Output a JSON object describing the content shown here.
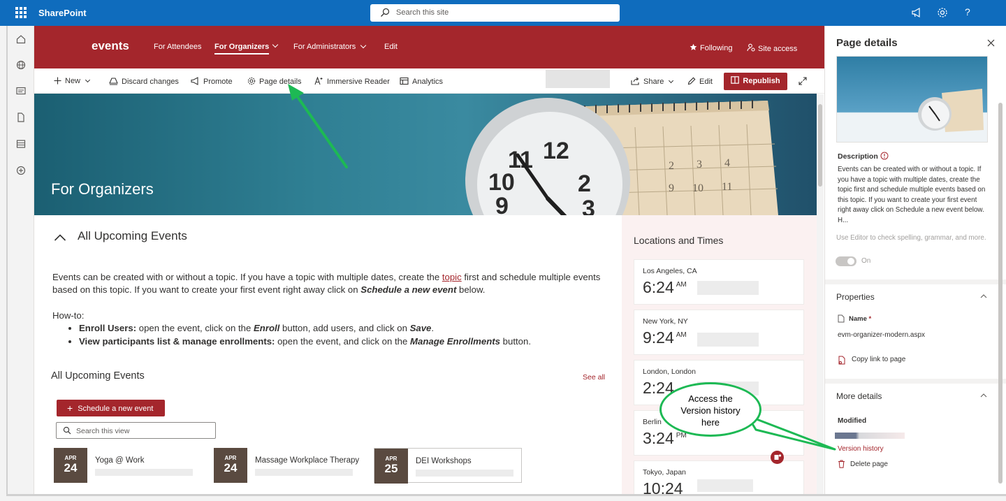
{
  "app": {
    "name": "SharePoint",
    "search_placeholder": "Search this site"
  },
  "colors": {
    "suite_bar": "#0f6cbd",
    "site_theme": "#a4262c",
    "annotation_green": "#1db954"
  },
  "site": {
    "name": "events",
    "nav": [
      {
        "label": "For Attendees",
        "active": false
      },
      {
        "label": "For Organizers",
        "active": true
      },
      {
        "label": "For Administrators",
        "active": false
      },
      {
        "label": "Edit",
        "active": false
      }
    ],
    "following": "Following",
    "site_access": "Site access"
  },
  "commands": {
    "new": "New",
    "discard": "Discard changes",
    "promote": "Promote",
    "page_details": "Page details",
    "immersive_reader": "Immersive Reader",
    "analytics": "Analytics",
    "share": "Share",
    "edit": "Edit",
    "republish": "Republish"
  },
  "hero": {
    "title": "For Organizers"
  },
  "content": {
    "section_title": "All Upcoming Events",
    "intro_1": "Events can be created with or without a topic. If you have a topic with multiple dates, create the ",
    "intro_link": "topic",
    "intro_2": " first and schedule multiple events based on this topic. If you want to create your first event right away click on ",
    "intro_bold": "Schedule a new event",
    "intro_3": " below.",
    "howto": "How-to:",
    "b1_bold": "Enroll Users:",
    "b1_text": " open the event, click on the ",
    "b1_em": "Enroll",
    "b1_text2": " button, add users, and click on ",
    "b1_em2": "Save",
    "b1_end": ".",
    "b2_bold": "View participants list & manage enrollments:",
    "b2_text": " open the event, and click on the ",
    "b2_em": "Manage Enrollments",
    "b2_end": " button.",
    "events_title": "All Upcoming Events",
    "see_all": "See all",
    "schedule_btn": "Schedule a new event",
    "search_view": "Search this view",
    "events": [
      {
        "month": "APR",
        "day": "24",
        "name": "Yoga @ Work"
      },
      {
        "month": "APR",
        "day": "24",
        "name": "Massage Workplace Therapy"
      },
      {
        "month": "APR",
        "day": "25",
        "name": "DEI Workshops"
      }
    ]
  },
  "locations": {
    "title": "Locations and Times",
    "items": [
      {
        "city": "Los Angeles, CA",
        "time": "6:24",
        "ampm": "AM"
      },
      {
        "city": "New York, NY",
        "time": "9:24",
        "ampm": "AM"
      },
      {
        "city": "London, London",
        "time": "2:24",
        "ampm": ""
      },
      {
        "city": "Berlin",
        "time": "3:24",
        "ampm": "PM"
      },
      {
        "city": "Tokyo, Japan",
        "time": "10:24",
        "ampm": ""
      }
    ]
  },
  "panel": {
    "title": "Page details",
    "description_label": "Description",
    "description": "Events can be created with or without a topic. If you have a topic with multiple dates, create the topic first and schedule multiple events based on this topic. If you want to create your first event right away click on Schedule a new event below. H...",
    "editor_hint": "Use Editor to check spelling, grammar, and more.",
    "toggle_state": "On",
    "properties": "Properties",
    "name_label": "Name",
    "required_mark": "*",
    "name_value": "evm-organizer-modern.aspx",
    "copy_link": "Copy link to page",
    "more_details": "More details",
    "modified": "Modified",
    "version_history": "Version history",
    "delete_page": "Delete page"
  },
  "annotation": {
    "callout": "Access the Version history here"
  }
}
